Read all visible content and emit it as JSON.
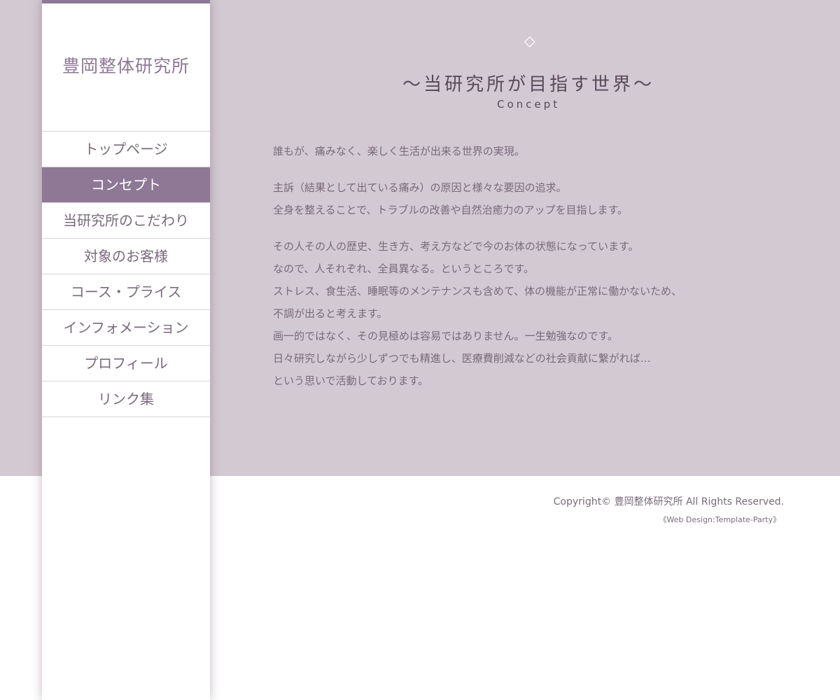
{
  "site": {
    "logo": "豊岡整体研究所"
  },
  "nav": {
    "items": [
      {
        "label": "トップページ"
      },
      {
        "label": "コンセプト",
        "active": true
      },
      {
        "label": "当研究所のこだわり"
      },
      {
        "label": "対象のお客様"
      },
      {
        "label": "コース・プライス"
      },
      {
        "label": "インフォメーション"
      },
      {
        "label": "プロフィール"
      },
      {
        "label": "リンク集"
      }
    ]
  },
  "main": {
    "heading": "〜当研究所が目指す世界〜",
    "subheading": "Concept",
    "paragraphs": [
      [
        "誰もが、痛みなく、楽しく生活が出来る世界の実現。"
      ],
      [
        "主訴（結果として出ている痛み）の原因と様々な要因の追求。",
        "全身を整えることで、トラブルの改善や自然治癒力のアップを目指します。"
      ],
      [
        "その人その人の歴史、生き方、考え方などで今のお体の状態になっています。",
        "なので、人それぞれ、全員異なる。というところです。",
        "ストレス、食生活、睡眠等のメンテナンスも含めて、体の機能が正常に働かないため、",
        "不調が出ると考えます。",
        "画一的ではなく、その見極めは容易ではありません。一生勉強なのです。",
        "日々研究しながら少しずつでも精進し、医療費削減などの社会貢献に繋がれば…",
        "という思いで活動しております。"
      ]
    ]
  },
  "footer": {
    "copyright": "Copyright© 豊岡整体研究所 All Rights Reserved.",
    "credit": "《Web Design:Template-Party》"
  },
  "colors": {
    "accent": "#8e7895",
    "band": "#d3c9d2",
    "text": "#7a6a7c"
  }
}
